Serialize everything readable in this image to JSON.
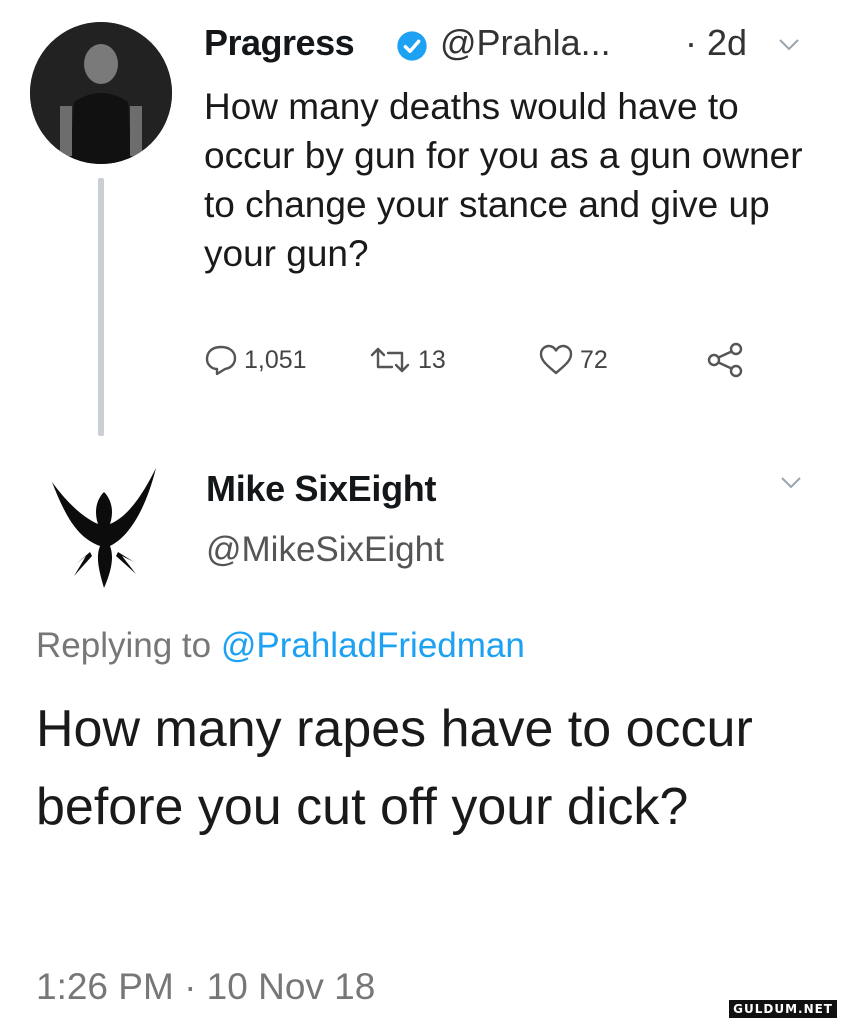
{
  "tweet1": {
    "display_name": "Pragress",
    "handle": "@Prahla...",
    "time": "· 2d",
    "text": "How many deaths would have to occur by gun for you as a gun owner to change your stance and give up your gun?",
    "replies": "1,051",
    "retweets": "13",
    "likes": "72"
  },
  "tweet2": {
    "display_name": "Mike SixEight",
    "handle": "@MikeSixEight",
    "replying_label": "Replying to",
    "replying_to": "@PrahladFriedman",
    "text": "How many rapes have to occur before you cut off your dick?",
    "timestamp": "1:26 PM · 10 Nov 18"
  },
  "watermark": "GULDUM.NET",
  "colors": {
    "link_blue": "#1da1f2",
    "verified_blue": "#1da1f2",
    "muted": "#777777"
  },
  "icons": [
    "verified-badge-icon",
    "chevron-down-icon",
    "reply-icon",
    "retweet-icon",
    "like-icon",
    "share-icon"
  ]
}
